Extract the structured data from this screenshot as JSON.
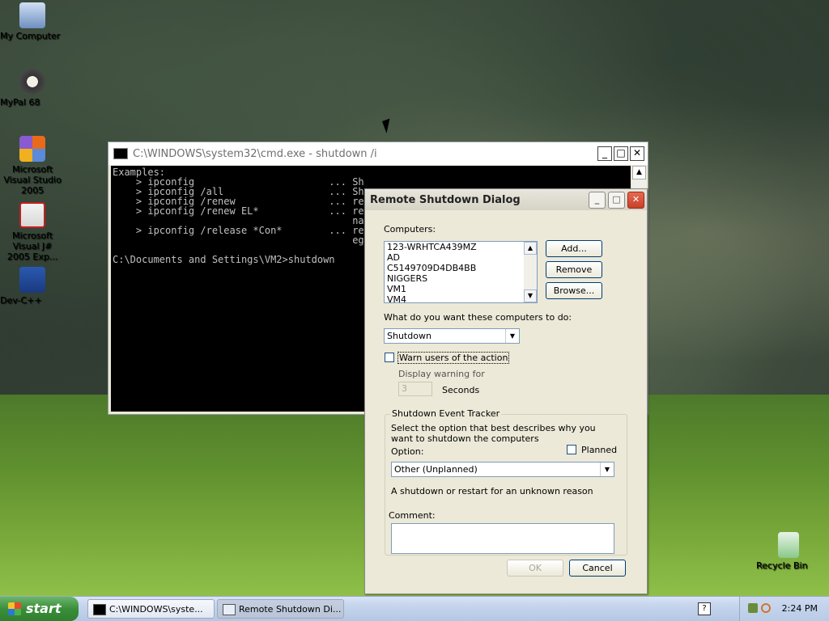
{
  "desktop": {
    "icons": [
      {
        "label": "My Computer"
      },
      {
        "label": "MyPal 68"
      },
      {
        "label": "Microsoft Visual Studio 2005"
      },
      {
        "label": "Microsoft Visual J# 2005 Exp..."
      },
      {
        "label": "Dev-C++"
      },
      {
        "label": "Recycle Bin"
      }
    ]
  },
  "cmd": {
    "title": "C:\\WINDOWS\\system32\\cmd.exe - shutdown /i",
    "lines": [
      "Examples:",
      "    > ipconfig                       ... Sh",
      "    > ipconfig /all                  ... Sh",
      "    > ipconfig /renew                ... re",
      "    > ipconfig /renew EL*            ... re",
      "                                         na",
      "    > ipconfig /release *Con*        ... re",
      "                                         eg",
      "",
      "C:\\Documents and Settings\\VM2>shutdown"
    ]
  },
  "dialog": {
    "title": "Remote Shutdown Dialog",
    "computers_label": "Computers:",
    "computers": [
      "123-WRHTCA439MZ",
      "AD",
      "C5149709D4DB4BB",
      "NIGGERS",
      "VM1",
      "VM4"
    ],
    "add_label": "Add...",
    "remove_label": "Remove",
    "browse_label": "Browse...",
    "action_label": "What do you want these computers to do:",
    "action_value": "Shutdown",
    "warn_label": "Warn users of the action",
    "display_warning_label": "Display warning for",
    "warning_seconds": "3",
    "seconds_label": "Seconds",
    "tracker_label": "Shutdown Event Tracker",
    "tracker_desc": "Select the option that best describes why you want to shutdown the computers",
    "option_label": "Option:",
    "planned_label": "Planned",
    "option_value": "Other (Unplanned)",
    "reason_text": "A shutdown or restart for an unknown reason",
    "comment_label": "Comment:",
    "ok_label": "OK",
    "cancel_label": "Cancel"
  },
  "taskbar": {
    "start_label": "start",
    "tasks": [
      {
        "label": "C:\\WINDOWS\\syste..."
      },
      {
        "label": "Remote Shutdown Di..."
      }
    ],
    "clock": "2:24 PM"
  }
}
